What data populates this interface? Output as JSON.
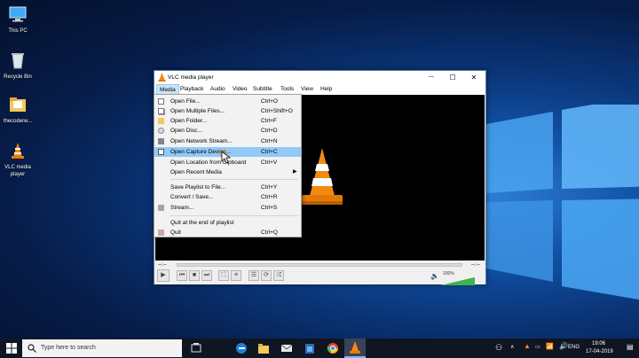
{
  "desktop": {
    "icons": [
      {
        "label": "This PC"
      },
      {
        "label": "Recycle Bin"
      },
      {
        "label": "thecoderw..."
      },
      {
        "label": "VLC media player"
      }
    ]
  },
  "vlc": {
    "title": "VLC media player",
    "window_buttons": {
      "minimize": "—",
      "maximize": "☐",
      "close": "✕"
    },
    "menus": [
      "Media",
      "Playback",
      "Audio",
      "Video",
      "Subtitle",
      "Tools",
      "View",
      "Help"
    ],
    "active_menu": "Media",
    "time_elapsed": "--:--",
    "time_total": "--:--",
    "volume": "100%",
    "volume_level": 1.0
  },
  "media_menu": {
    "items": [
      {
        "label": "Open File...",
        "shortcut": "Ctrl+O",
        "icon": "file-icon"
      },
      {
        "label": "Open Multiple Files...",
        "shortcut": "Ctrl+Shift+O",
        "icon": "files-icon"
      },
      {
        "label": "Open Folder...",
        "shortcut": "Ctrl+F",
        "icon": "folder-icon"
      },
      {
        "label": "Open Disc...",
        "shortcut": "Ctrl+D",
        "icon": "disc-icon"
      },
      {
        "label": "Open Network Stream...",
        "shortcut": "Ctrl+N",
        "icon": "network-icon"
      },
      {
        "label": "Open Capture Device...",
        "shortcut": "Ctrl+C",
        "icon": "capture-icon"
      },
      {
        "label": "Open Location from clipboard",
        "shortcut": "Ctrl+V",
        "icon": ""
      },
      {
        "label": "Open Recent Media",
        "shortcut": "",
        "icon": ""
      },
      {
        "label": "Save Playlist to File...",
        "shortcut": "Ctrl+Y",
        "icon": ""
      },
      {
        "label": "Convert / Save...",
        "shortcut": "Ctrl+R",
        "icon": ""
      },
      {
        "label": "Stream...",
        "shortcut": "Ctrl+S",
        "icon": "stream-icon"
      },
      {
        "label": "Quit at the end of playlist",
        "shortcut": "",
        "icon": ""
      },
      {
        "label": "Quit",
        "shortcut": "Ctrl+Q",
        "icon": "quit-icon"
      }
    ],
    "highlighted": "Open Capture Device..."
  },
  "taskbar": {
    "search_placeholder": "Type here to search",
    "language": "ENG",
    "time": "19:06",
    "date": "17-04-2019"
  },
  "colors": {
    "menu_highlight": "#91c9f7",
    "vlc_orange": "#f28a12",
    "taskbar": "#101522"
  }
}
